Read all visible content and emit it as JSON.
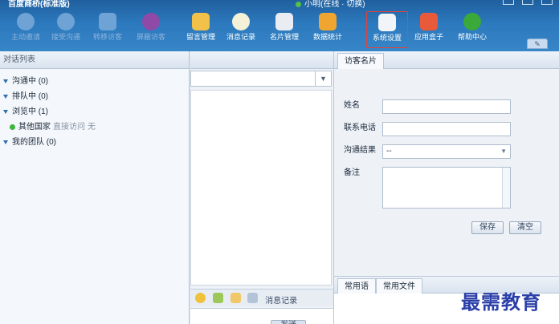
{
  "window": {
    "title": "百度商桥(标准版)",
    "status": "小明(在线 · 切换)",
    "colors": {
      "titlebar": "#2c79bd",
      "accent": "#e0443c",
      "online": "#54c04a"
    }
  },
  "toolbar": {
    "items": [
      {
        "id": "invite",
        "label": "主动邀请",
        "icon": "chat-bubble-icon",
        "enabled": false,
        "color": "#6fa3d6"
      },
      {
        "id": "accept",
        "label": "接受沟通",
        "icon": "chat-bubbles-icon",
        "enabled": false,
        "color": "#6fa3d6"
      },
      {
        "id": "transfer",
        "label": "转移访客",
        "icon": "transfer-user-icon",
        "enabled": false,
        "color": "#6fa3d6"
      },
      {
        "id": "block",
        "label": "屏蔽访客",
        "icon": "block-icon",
        "enabled": false,
        "color": "#8e4aa6"
      },
      {
        "id": "messages",
        "label": "留言管理",
        "icon": "envelope-icon",
        "enabled": true,
        "color": "#f2c14a"
      },
      {
        "id": "history",
        "label": "消息记录",
        "icon": "clock-icon",
        "enabled": true,
        "color": "#f5f0d8"
      },
      {
        "id": "cards",
        "label": "名片管理",
        "icon": "id-card-icon",
        "enabled": true,
        "color": "#e9edf3"
      },
      {
        "id": "stats",
        "label": "数据统计",
        "icon": "bar-chart-icon",
        "enabled": true,
        "color": "#f0a531"
      },
      {
        "id": "settings",
        "label": "系统设置",
        "icon": "settings-panel-icon",
        "enabled": true,
        "active": true,
        "color": "#f1f4f8"
      },
      {
        "id": "apps",
        "label": "应用盒子",
        "icon": "apps-grid-icon",
        "enabled": true,
        "color": "#e85a3a"
      },
      {
        "id": "help",
        "label": "帮助中心",
        "icon": "help-icon",
        "enabled": true,
        "color": "#3aa93a"
      }
    ]
  },
  "left_panel": {
    "title": "对话列表",
    "groups": [
      {
        "label": "沟通中",
        "count": "(0)"
      },
      {
        "label": "排队中",
        "count": "(0)"
      },
      {
        "label": "浏览中",
        "count": "(1)"
      },
      {
        "label": "我的团队",
        "count": "(0)"
      }
    ],
    "visitor": {
      "name": "其他国家",
      "source": "直接访问",
      "keyword": "无"
    }
  },
  "chat": {
    "tools": {
      "history_label": "消息记录"
    },
    "send_label": "发送"
  },
  "visitor_card": {
    "tab": "访客名片",
    "name_label": "姓名",
    "phone_label": "联系电话",
    "result_label": "沟通结果",
    "result_value": "--",
    "note_label": "备注",
    "save_label": "保存",
    "clear_label": "清空",
    "bottom_tabs": [
      "常用语",
      "常用文件"
    ]
  },
  "watermark": "最需教育"
}
